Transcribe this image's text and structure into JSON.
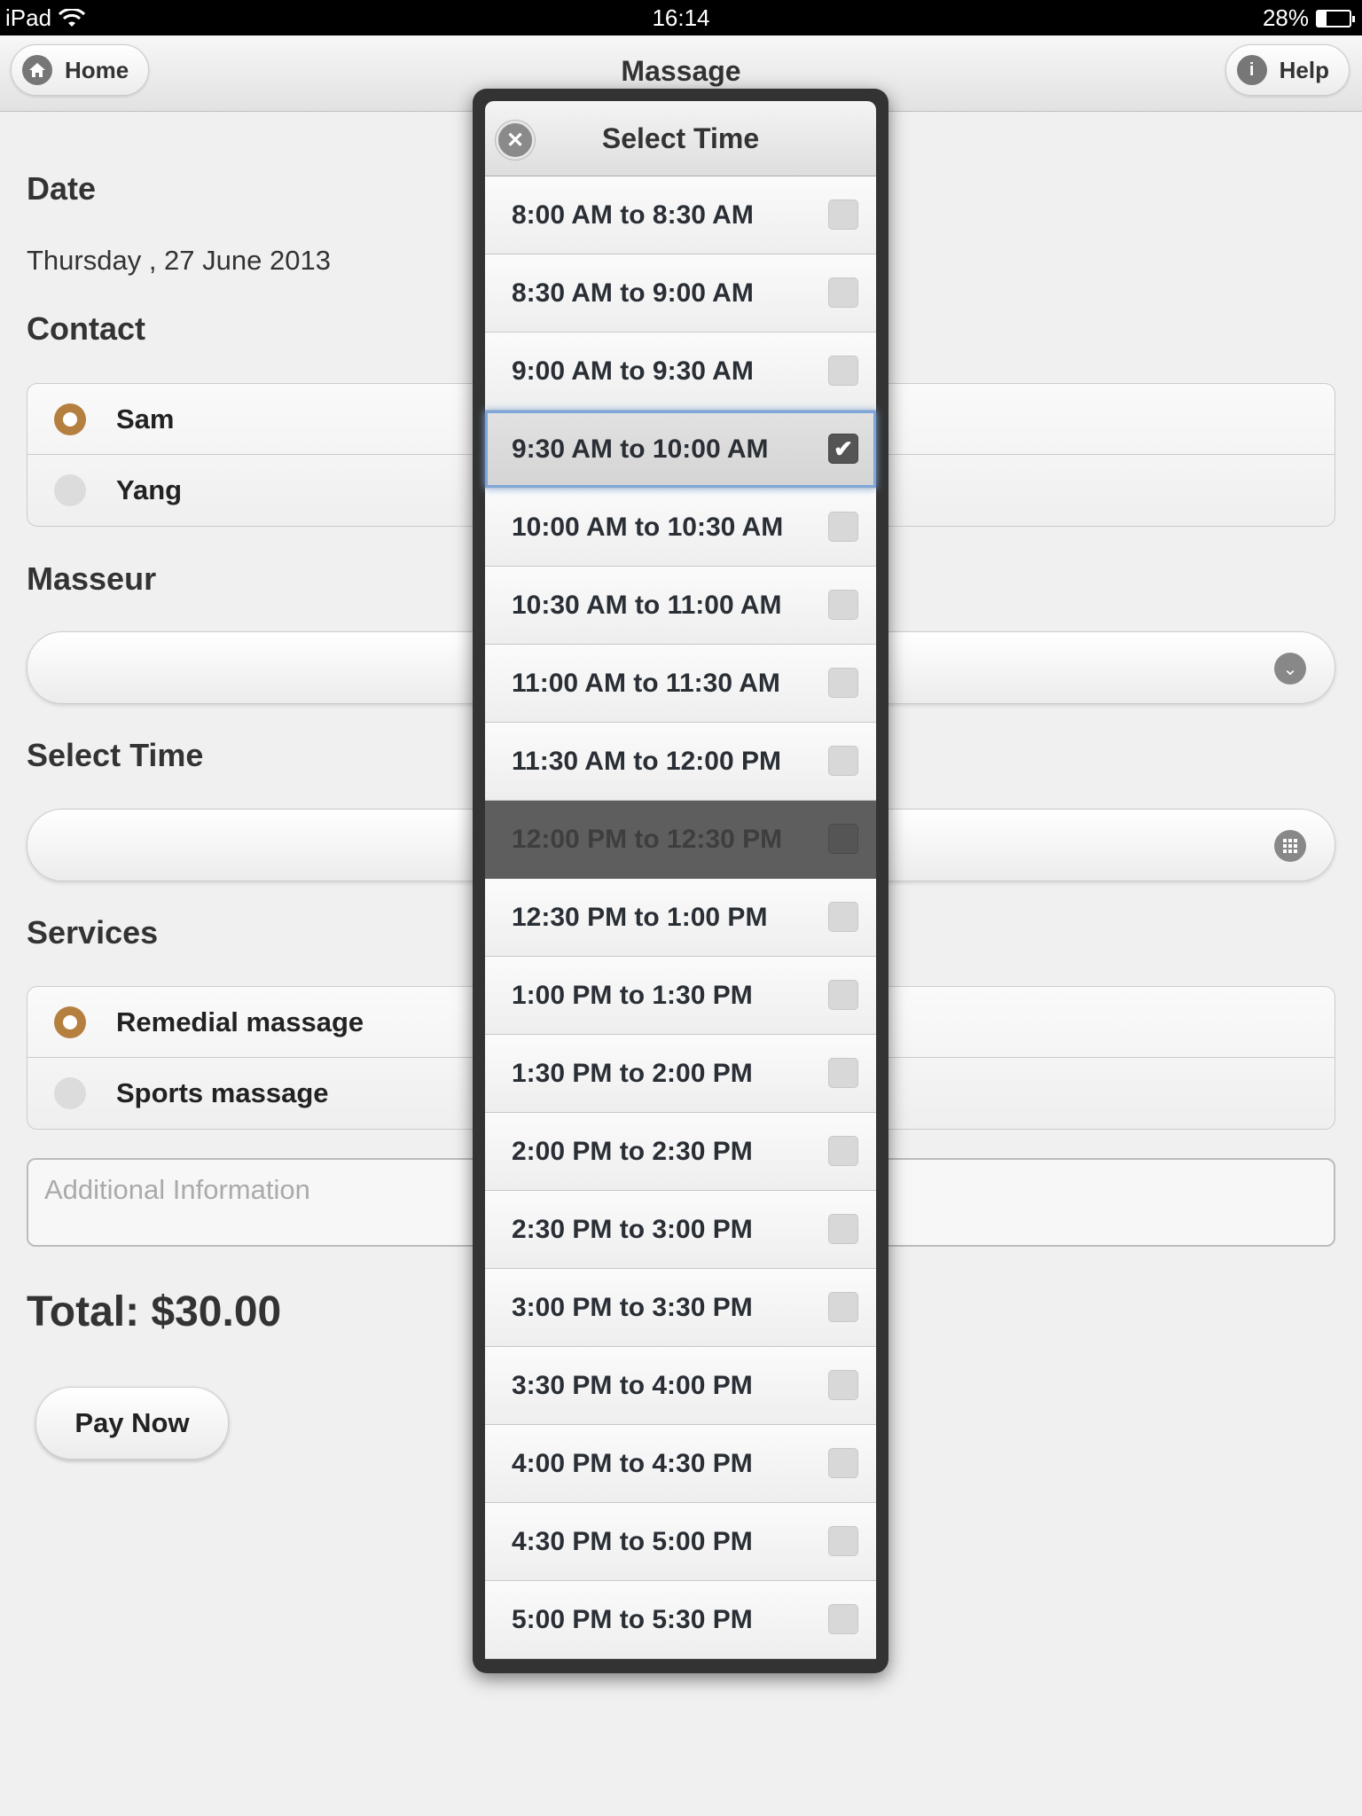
{
  "status_bar": {
    "device": "iPad",
    "time": "16:14",
    "battery": "28%",
    "battery_level": 0.28
  },
  "header": {
    "title": "Massage",
    "home_label": "Home",
    "help_label": "Help"
  },
  "form": {
    "date_label": "Date",
    "date_value": "Thursday , 27 June 2013",
    "contact_label": "Contact",
    "contacts": [
      {
        "name": "Sam",
        "selected": true
      },
      {
        "name": "Yang",
        "selected": false
      }
    ],
    "masseur_label": "Masseur",
    "masseur_value": "",
    "select_time_label": "Select Time",
    "select_time_value": "",
    "services_label": "Services",
    "services": [
      {
        "name": "Remedial massage",
        "selected": true
      },
      {
        "name": "Sports massage",
        "selected": false
      }
    ],
    "additional_placeholder": "Additional Information",
    "total": "Total: $30.00",
    "pay_label": "Pay Now"
  },
  "popup": {
    "title": "Select Time",
    "slots": [
      {
        "label": "8:00 AM to 8:30 AM",
        "checked": false
      },
      {
        "label": "8:30 AM to 9:00 AM",
        "checked": false
      },
      {
        "label": "9:00 AM to 9:30 AM",
        "checked": false
      },
      {
        "label": "9:30 AM to 10:00 AM",
        "checked": true
      },
      {
        "label": "10:00 AM to 10:30 AM",
        "checked": false
      },
      {
        "label": "10:30 AM to 11:00 AM",
        "checked": false
      },
      {
        "label": "11:00 AM to 11:30 AM",
        "checked": false
      },
      {
        "label": "11:30 AM to 12:00 PM",
        "checked": false
      },
      {
        "label": "12:00 PM to 12:30 PM",
        "checked": false,
        "disabled": true
      },
      {
        "label": "12:30 PM to 1:00 PM",
        "checked": false
      },
      {
        "label": "1:00 PM to 1:30 PM",
        "checked": false
      },
      {
        "label": "1:30 PM to 2:00 PM",
        "checked": false
      },
      {
        "label": "2:00 PM to 2:30 PM",
        "checked": false
      },
      {
        "label": "2:30 PM to 3:00 PM",
        "checked": false
      },
      {
        "label": "3:00 PM to 3:30 PM",
        "checked": false
      },
      {
        "label": "3:30 PM to 4:00 PM",
        "checked": false
      },
      {
        "label": "4:00 PM to 4:30 PM",
        "checked": false
      },
      {
        "label": "4:30 PM to 5:00 PM",
        "checked": false
      },
      {
        "label": "5:00 PM to 5:30 PM",
        "checked": false
      }
    ]
  },
  "icons": {
    "home": "home-icon",
    "help": "info-icon",
    "close": "close-icon",
    "dropdown": "chevron-down-icon",
    "grid": "grid-icon",
    "check": "check-icon",
    "wifi": "wifi-icon",
    "battery": "battery-icon"
  },
  "colors": {
    "radio_selected": "#b5803f",
    "checked_highlight": "#7fa6d8",
    "background": "#f0f0f0"
  }
}
